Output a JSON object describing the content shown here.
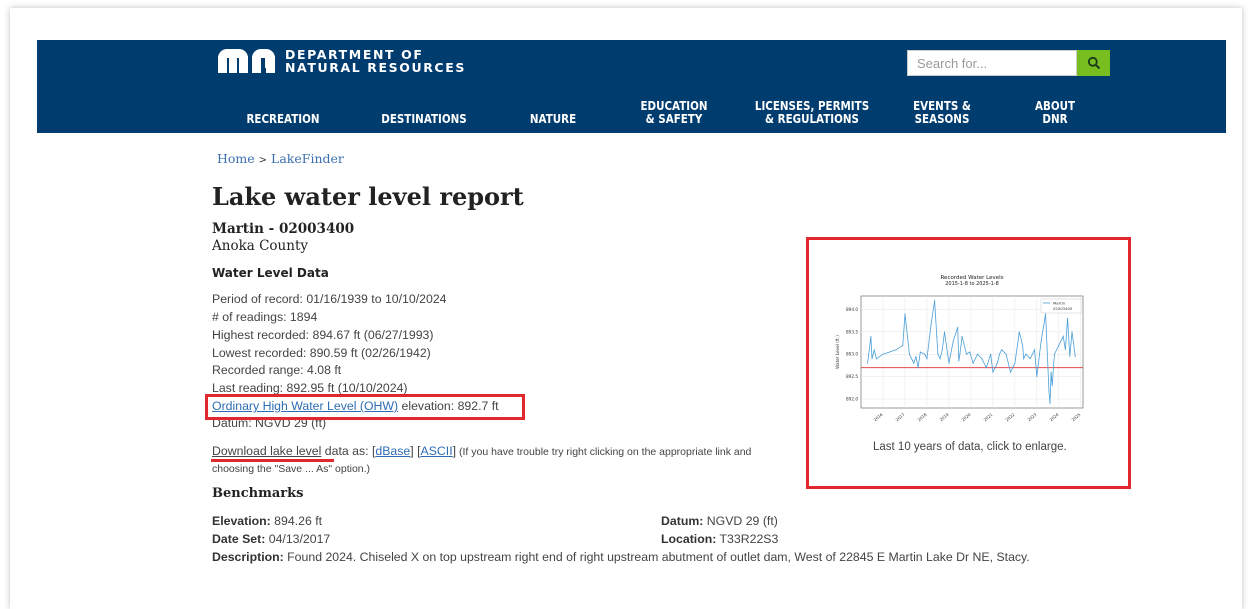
{
  "header": {
    "logo_line1": "DEPARTMENT OF",
    "logo_line2": "NATURAL RESOURCES",
    "search_placeholder": "Search for...",
    "nav": [
      {
        "line1": "RECREATION",
        "line2": ""
      },
      {
        "line1": "DESTINATIONS",
        "line2": ""
      },
      {
        "line1": "NATURE",
        "line2": ""
      },
      {
        "line1": "EDUCATION",
        "line2": "& SAFETY"
      },
      {
        "line1": "LICENSES, PERMITS",
        "line2": "& REGULATIONS"
      },
      {
        "line1": "EVENTS &",
        "line2": "SEASONS"
      },
      {
        "line1": "ABOUT",
        "line2": "DNR"
      }
    ],
    "colors": {
      "bar": "#013c6f",
      "search_button": "#78be20"
    }
  },
  "breadcrumb": {
    "home": "Home",
    "separator": ">",
    "current": "LakeFinder"
  },
  "title": "Lake water level report",
  "lake": {
    "name": "Martin - 02003400",
    "county": "Anoka County"
  },
  "water_level": {
    "heading": "Water Level Data",
    "period": "Period of record: 01/16/1939 to 10/10/2024",
    "readings": "# of readings: 1894",
    "highest": "Highest recorded: 894.67 ft (06/27/1993)",
    "lowest": "Lowest recorded: 890.59 ft (02/26/1942)",
    "range": "Recorded range: 4.08 ft",
    "last": "Last reading: 892.95 ft (10/10/2024)",
    "ohw_link": "Ordinary High Water Level (OHW)",
    "ohw_value": " elevation: 892.7 ft",
    "datum": "Datum: NGVD 29 (ft)"
  },
  "download": {
    "link": "Download lake level",
    "text": " data as: ",
    "dbase": "dBase",
    "ascii": "ASCII",
    "note1": " (If you have trouble try right clicking on the appropriate link and",
    "note2": "choosing the \"Save ... As\" option.)"
  },
  "benchmarks": {
    "heading": "Benchmarks",
    "elevation_label": "Elevation:",
    "elevation": " 894.26 ft",
    "date_label": "Date Set:",
    "date": " 04/13/2017",
    "datum_label": "Datum:",
    "datum": " NGVD 29 (ft)",
    "location_label": "Location:",
    "location": " T33R22S3",
    "description_label": "Description:",
    "description": " Found 2024. Chiseled X on top upstream right end of right upstream abutment of outlet dam, West of 22845 E Martin Lake Dr NE, Stacy."
  },
  "chart_caption": "Last 10 years of data, click to enlarge.",
  "chart_data": {
    "type": "line",
    "title": "Recorded Water Levels",
    "subtitle": "2015-1-8 to 2025-1-8",
    "ylabel": "Water Level (ft.)",
    "ylim": [
      891.8,
      894.3
    ],
    "y_ticks": [
      892.0,
      892.5,
      893.0,
      893.5,
      894.0
    ],
    "x_ticks": [
      "2016",
      "2017",
      "2018",
      "2019",
      "2020",
      "2021",
      "2022",
      "2023",
      "2024",
      "2025"
    ],
    "legend": [
      "Martin",
      "02003400"
    ],
    "legend_position": "top-right",
    "ohw_level": 892.7,
    "colors": {
      "series": "#4a9fd8",
      "ohw": "#e03030"
    },
    "series": [
      {
        "name": "Martin",
        "x": [
          2015.3,
          2015.45,
          2015.5,
          2015.6,
          2015.7,
          2016.0,
          2016.3,
          2016.6,
          2016.9,
          2017.0,
          2017.2,
          2017.4,
          2017.5,
          2017.6,
          2017.7,
          2017.9,
          2018.0,
          2018.2,
          2018.35,
          2018.45,
          2018.5,
          2018.6,
          2018.7,
          2018.8,
          2019.0,
          2019.2,
          2019.4,
          2019.45,
          2019.5,
          2019.6,
          2019.8,
          2019.95,
          2020.1,
          2020.3,
          2020.5,
          2020.7,
          2020.9,
          2021.0,
          2021.2,
          2021.3,
          2021.4,
          2021.6,
          2021.8,
          2022.0,
          2022.2,
          2022.35,
          2022.4,
          2022.5,
          2022.7,
          2022.9,
          2023.0,
          2023.2,
          2023.4,
          2023.55,
          2023.6,
          2023.65,
          2023.7,
          2023.8,
          2024.0,
          2024.2,
          2024.3,
          2024.4,
          2024.5,
          2024.6,
          2024.75
        ],
        "y": [
          892.8,
          893.4,
          892.9,
          893.1,
          892.9,
          893.0,
          893.05,
          893.1,
          893.2,
          893.9,
          893.0,
          892.8,
          892.95,
          892.7,
          893.05,
          893.0,
          892.9,
          893.7,
          894.2,
          893.4,
          893.0,
          892.9,
          893.1,
          893.5,
          892.8,
          893.3,
          893.6,
          892.85,
          893.0,
          893.4,
          893.0,
          893.05,
          892.8,
          893.0,
          892.9,
          892.7,
          893.0,
          892.6,
          892.8,
          893.0,
          893.1,
          893.0,
          892.6,
          892.8,
          893.5,
          893.2,
          892.9,
          893.0,
          892.9,
          893.1,
          892.5,
          893.3,
          893.9,
          892.2,
          891.9,
          892.6,
          892.3,
          893.0,
          893.2,
          893.4,
          893.1,
          893.8,
          892.95,
          893.5,
          892.95
        ]
      }
    ]
  }
}
